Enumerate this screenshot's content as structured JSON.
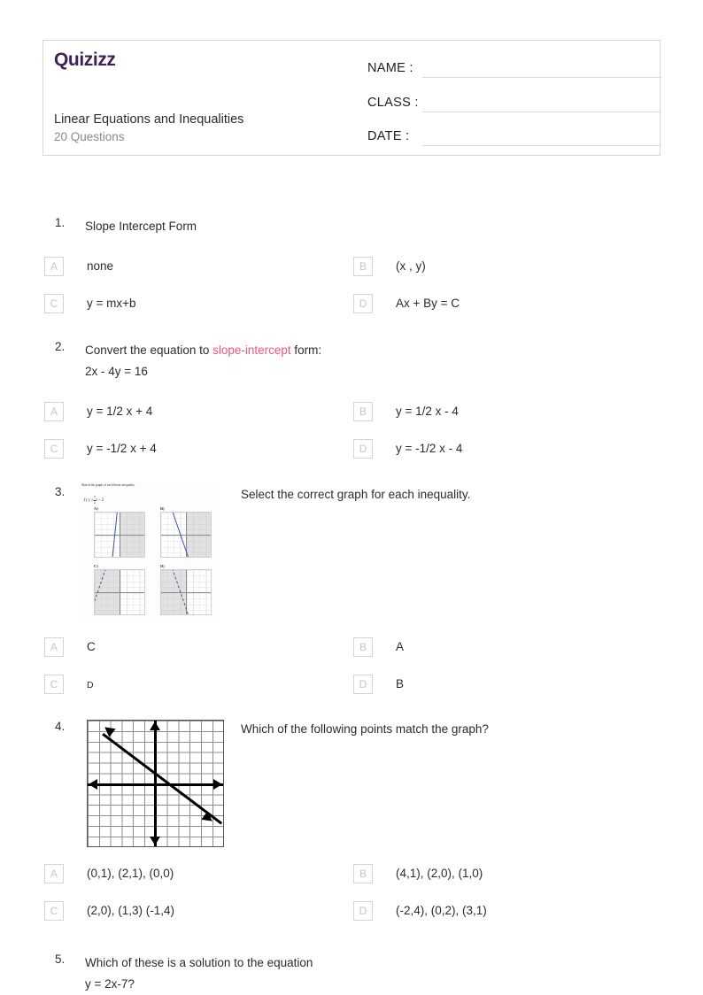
{
  "header": {
    "logo_text": "Quizizz",
    "quiz_title": "Linear Equations and Inequalities",
    "question_count_label": "20 Questions",
    "fields": [
      {
        "label": "NAME :",
        "value": ""
      },
      {
        "label": "CLASS :",
        "value": ""
      },
      {
        "label": "DATE  :",
        "value": ""
      }
    ]
  },
  "questions": [
    {
      "number": "1.",
      "text": "Slope Intercept Form",
      "options": [
        {
          "letter": "A",
          "text": "none"
        },
        {
          "letter": "B",
          "text": "(x , y)"
        },
        {
          "letter": "C",
          "text": "y = mx+b"
        },
        {
          "letter": "D",
          "text": "Ax + By = C"
        }
      ]
    },
    {
      "number": "2.",
      "text_before": "Convert the equation to ",
      "text_highlight": "slope-intercept",
      "text_after": " form:",
      "text_line2": "2x - 4y = 16",
      "options": [
        {
          "letter": "A",
          "text": "y = 1/2 x + 4"
        },
        {
          "letter": "B",
          "text": "y = 1/2 x - 4"
        },
        {
          "letter": "C",
          "text": "y = -1/2 x + 4"
        },
        {
          "letter": "D",
          "text": "y = -1/2 x - 4"
        }
      ]
    },
    {
      "number": "3.",
      "text": "Select the correct graph for each inequality.",
      "image": {
        "caption": "Sketch the graph of each linear inequality.",
        "equation_prefix": "1)  y ≥",
        "equation_num": "7",
        "equation_den": "2",
        "equation_suffix": "x - 2",
        "panel_labels": [
          "A)",
          "B)",
          "C)",
          "D)"
        ]
      },
      "options": [
        {
          "letter": "A",
          "text": "C"
        },
        {
          "letter": "B",
          "text": "A"
        },
        {
          "letter": "C",
          "text": "D",
          "small": true
        },
        {
          "letter": "D",
          "text": "B"
        }
      ]
    },
    {
      "number": "4.",
      "text": "Which of the following points match the graph?",
      "options": [
        {
          "letter": "A",
          "text": "(0,1), (2,1), (0,0)"
        },
        {
          "letter": "B",
          "text": "(4,1), (2,0), (1,0)"
        },
        {
          "letter": "C",
          "text": "(2,0), (1,3) (-1,4)"
        },
        {
          "letter": "D",
          "text": "(-2,4), (0,2), (3,1)"
        }
      ]
    },
    {
      "number": "5.",
      "text_line1": "Which of these is a solution to the equation",
      "text_line2": "y = 2x-7?"
    }
  ],
  "colors": {
    "logo_purple": "#3f2153",
    "highlight_pink": "#e8577f",
    "border_gray": "#d6d6d6",
    "muted_gray": "#8a8a8a",
    "option_box_gray": "#d4d4d4",
    "graph_blue": "#3b55a5"
  }
}
